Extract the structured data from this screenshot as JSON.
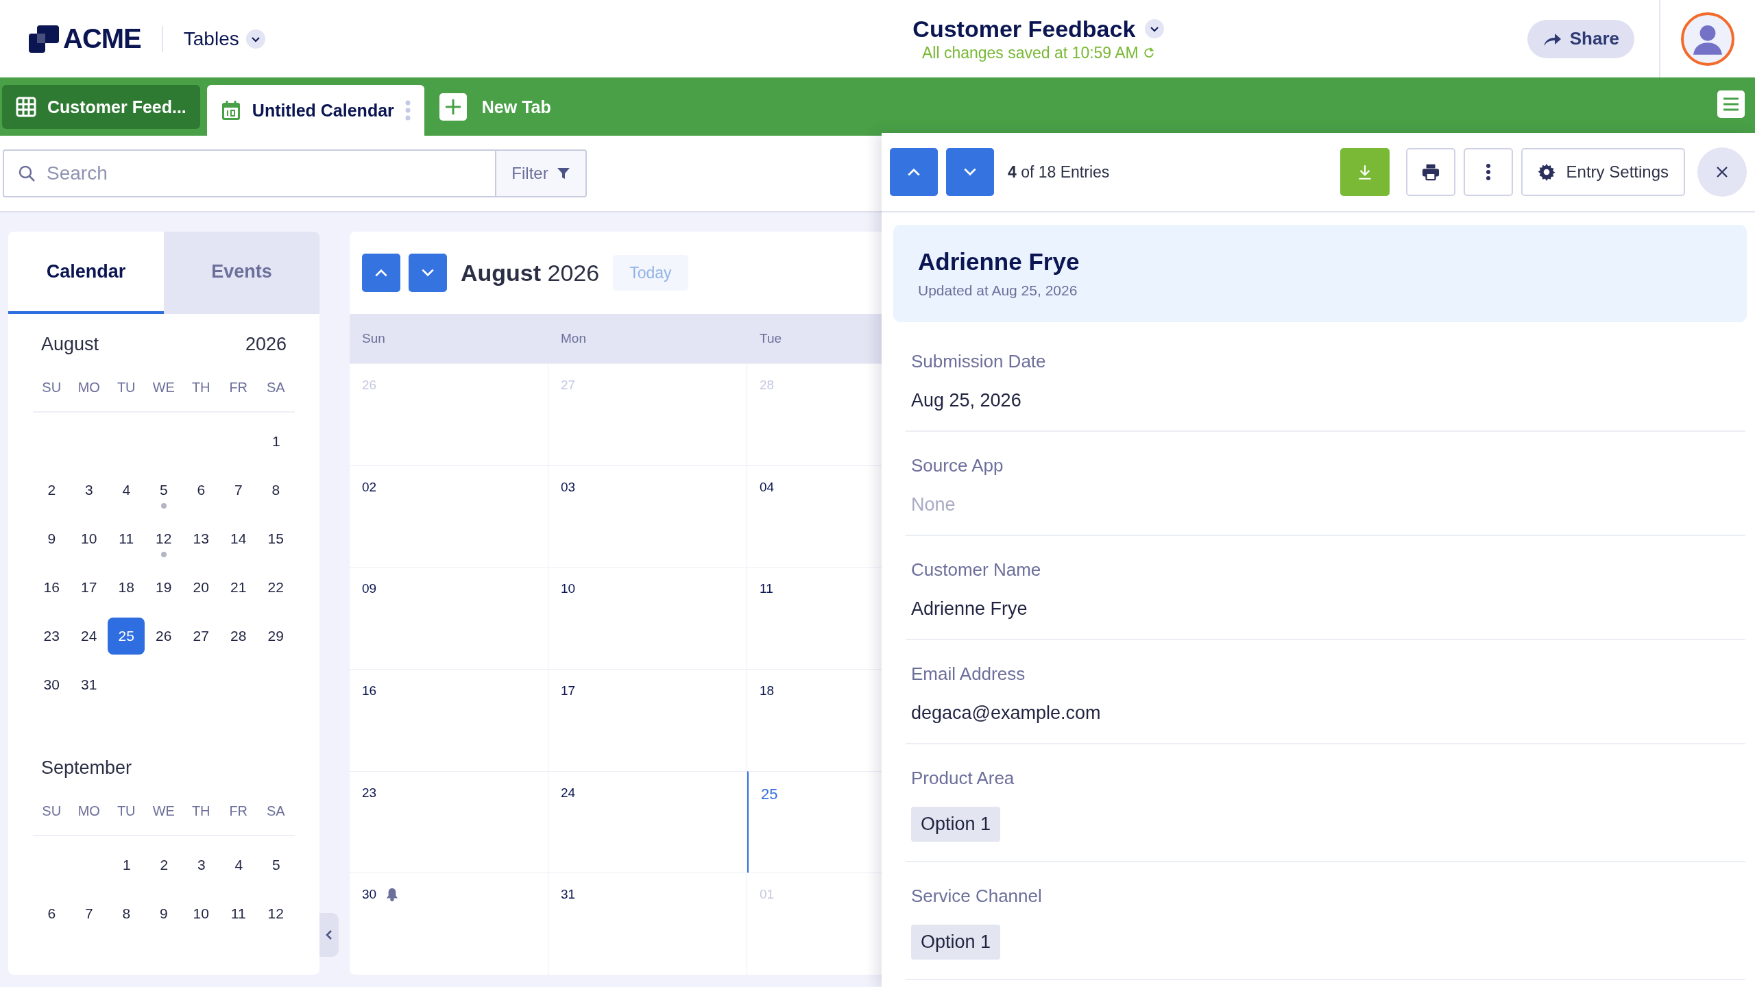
{
  "header": {
    "logo": "ACME",
    "app_menu": "Tables",
    "title": "Customer Feedback",
    "save_status": "All changes saved at 10:59 AM",
    "share": "Share"
  },
  "tabs": [
    {
      "kind": "table",
      "label": "Customer Feed...",
      "selected": false
    },
    {
      "kind": "calendar",
      "label": "Untitled Calendar",
      "selected": true
    }
  ],
  "new_tab": "New Tab",
  "search": {
    "placeholder": "Search",
    "filter": "Filter"
  },
  "side_tabs": [
    {
      "label": "Calendar",
      "selected": true
    },
    {
      "label": "Events",
      "selected": false
    }
  ],
  "mini_months": [
    {
      "month": "August",
      "year": "2026",
      "weekdays": [
        "SU",
        "MO",
        "TU",
        "WE",
        "TH",
        "FR",
        "SA"
      ],
      "weeks": [
        [
          {
            "day": "1",
            "selected": false,
            "event": false
          }
        ],
        [
          {
            "day": "2",
            "selected": false,
            "event": false
          },
          {
            "day": "3",
            "selected": false,
            "event": false
          },
          {
            "day": "4",
            "selected": false,
            "event": false
          },
          {
            "day": "5",
            "selected": false,
            "event": true
          },
          {
            "day": "6",
            "selected": false,
            "event": false
          },
          {
            "day": "7",
            "selected": false,
            "event": false
          },
          {
            "day": "8",
            "selected": false,
            "event": false
          }
        ],
        [
          {
            "day": "9",
            "selected": false,
            "event": false
          },
          {
            "day": "10",
            "selected": false,
            "event": false
          },
          {
            "day": "11",
            "selected": false,
            "event": false
          },
          {
            "day": "12",
            "selected": false,
            "event": true
          },
          {
            "day": "13",
            "selected": false,
            "event": false
          },
          {
            "day": "14",
            "selected": false,
            "event": false
          },
          {
            "day": "15",
            "selected": false,
            "event": false
          }
        ],
        [
          {
            "day": "16",
            "selected": false,
            "event": false
          },
          {
            "day": "17",
            "selected": false,
            "event": false
          },
          {
            "day": "18",
            "selected": false,
            "event": false
          },
          {
            "day": "19",
            "selected": false,
            "event": false
          },
          {
            "day": "20",
            "selected": false,
            "event": false
          },
          {
            "day": "21",
            "selected": false,
            "event": false
          },
          {
            "day": "22",
            "selected": false,
            "event": false
          }
        ],
        [
          {
            "day": "23",
            "selected": false,
            "event": false
          },
          {
            "day": "24",
            "selected": false,
            "event": false
          },
          {
            "day": "25",
            "selected": true,
            "event": false
          },
          {
            "day": "26",
            "selected": false,
            "event": false
          },
          {
            "day": "27",
            "selected": false,
            "event": false
          },
          {
            "day": "28",
            "selected": false,
            "event": false
          },
          {
            "day": "29",
            "selected": false,
            "event": false
          }
        ],
        [
          {
            "day": "30",
            "selected": false,
            "event": false
          },
          {
            "day": "31",
            "selected": false,
            "event": false
          }
        ]
      ]
    },
    {
      "month": "September",
      "weekdays": [
        "SU",
        "MO",
        "TU",
        "WE",
        "TH",
        "FR",
        "SA"
      ],
      "weeks": [
        [
          {
            "day": "1",
            "selected": false,
            "event": false
          },
          {
            "day": "2",
            "selected": false,
            "event": false
          },
          {
            "day": "3",
            "selected": false,
            "event": false
          },
          {
            "day": "4",
            "selected": false,
            "event": false
          },
          {
            "day": "5",
            "selected": false,
            "event": false
          }
        ],
        [
          {
            "day": "6",
            "selected": false,
            "event": false
          },
          {
            "day": "7",
            "selected": false,
            "event": false
          },
          {
            "day": "8",
            "selected": false,
            "event": false
          },
          {
            "day": "9",
            "selected": false,
            "event": false
          },
          {
            "day": "10",
            "selected": false,
            "event": false
          },
          {
            "day": "11",
            "selected": false,
            "event": false
          },
          {
            "day": "12",
            "selected": false,
            "event": false
          }
        ]
      ]
    }
  ],
  "calendar": {
    "title": "**August** 2026",
    "today": "Today",
    "columns": [
      "Sun",
      "Mon",
      "Tue"
    ],
    "weeks": [
      [
        {
          "day": "26",
          "outside": true,
          "today": false,
          "reminder": false
        },
        {
          "day": "27",
          "outside": true,
          "today": false,
          "reminder": false
        },
        {
          "day": "28",
          "outside": true,
          "today": false,
          "reminder": false
        }
      ],
      [
        {
          "day": "02",
          "outside": false,
          "today": false,
          "reminder": false
        },
        {
          "day": "03",
          "outside": false,
          "today": false,
          "reminder": false
        },
        {
          "day": "04",
          "outside": false,
          "today": false,
          "reminder": false
        }
      ],
      [
        {
          "day": "09",
          "outside": false,
          "today": false,
          "reminder": false
        },
        {
          "day": "10",
          "outside": false,
          "today": false,
          "reminder": false
        },
        {
          "day": "11",
          "outside": false,
          "today": false,
          "reminder": false
        }
      ],
      [
        {
          "day": "16",
          "outside": false,
          "today": false,
          "reminder": false
        },
        {
          "day": "17",
          "outside": false,
          "today": false,
          "reminder": false
        },
        {
          "day": "18",
          "outside": false,
          "today": false,
          "reminder": false
        }
      ],
      [
        {
          "day": "23",
          "outside": false,
          "today": false,
          "reminder": false
        },
        {
          "day": "24",
          "outside": false,
          "today": false,
          "reminder": false
        },
        {
          "day": "25",
          "outside": false,
          "today": true,
          "reminder": false
        }
      ],
      [
        {
          "day": "30",
          "outside": false,
          "today": false,
          "reminder": true
        },
        {
          "day": "31",
          "outside": false,
          "today": false,
          "reminder": false
        },
        {
          "day": "01",
          "outside": true,
          "today": false,
          "reminder": false
        }
      ]
    ]
  },
  "entry": {
    "position": "**4** of 18 Entries",
    "settings": "Entry Settings",
    "name": "Adrienne Frye",
    "updated": "Updated at Aug 25, 2026",
    "fields": [
      {
        "label": "Submission Date",
        "kind": "text",
        "value": "Aug 25, 2026"
      },
      {
        "label": "Source App",
        "kind": "empty",
        "value": "None"
      },
      {
        "label": "Customer Name",
        "kind": "text",
        "value": "Adrienne Frye"
      },
      {
        "label": "Email Address",
        "kind": "text",
        "value": "degaca@example.com"
      },
      {
        "label": "Product Area",
        "kind": "tag",
        "value": "Option 1"
      },
      {
        "label": "Service Channel",
        "kind": "tag",
        "value": "Option 1"
      }
    ]
  }
}
